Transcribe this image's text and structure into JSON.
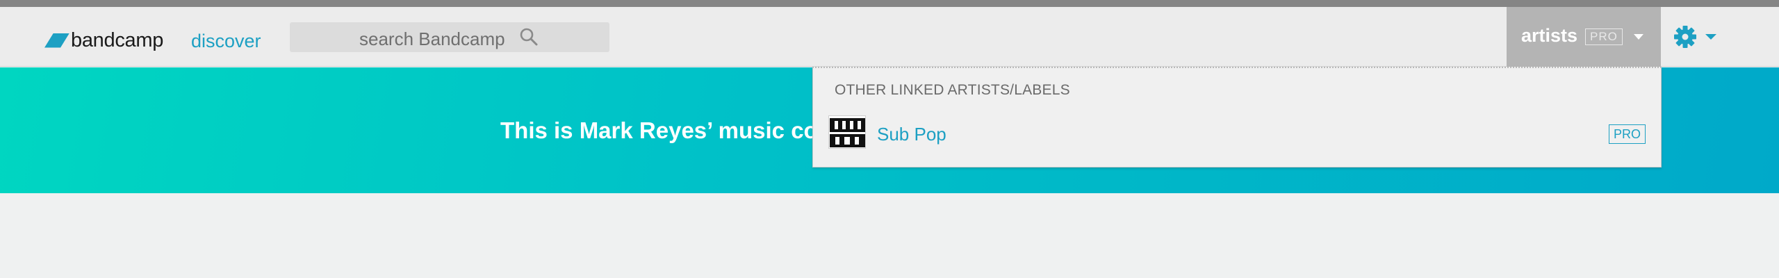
{
  "colors": {
    "accent": "#1da0c3",
    "header_bg": "#ececec",
    "banner_start": "#00d6c1",
    "banner_end": "#00a9c9"
  },
  "header": {
    "logo_text": "bandcamp",
    "discover_label": "discover",
    "search": {
      "placeholder": "search Bandcamp",
      "icon": "search-icon"
    },
    "artists_label": "artists",
    "pro_badge": "PRO",
    "settings_icon": "gear-icon"
  },
  "banner": {
    "text": "This is Mark Reyes’ music colle"
  },
  "dropdown": {
    "heading": "OTHER LINKED ARTISTS/LABELS",
    "items": [
      {
        "name": "Sub Pop",
        "badge": "PRO"
      }
    ]
  }
}
